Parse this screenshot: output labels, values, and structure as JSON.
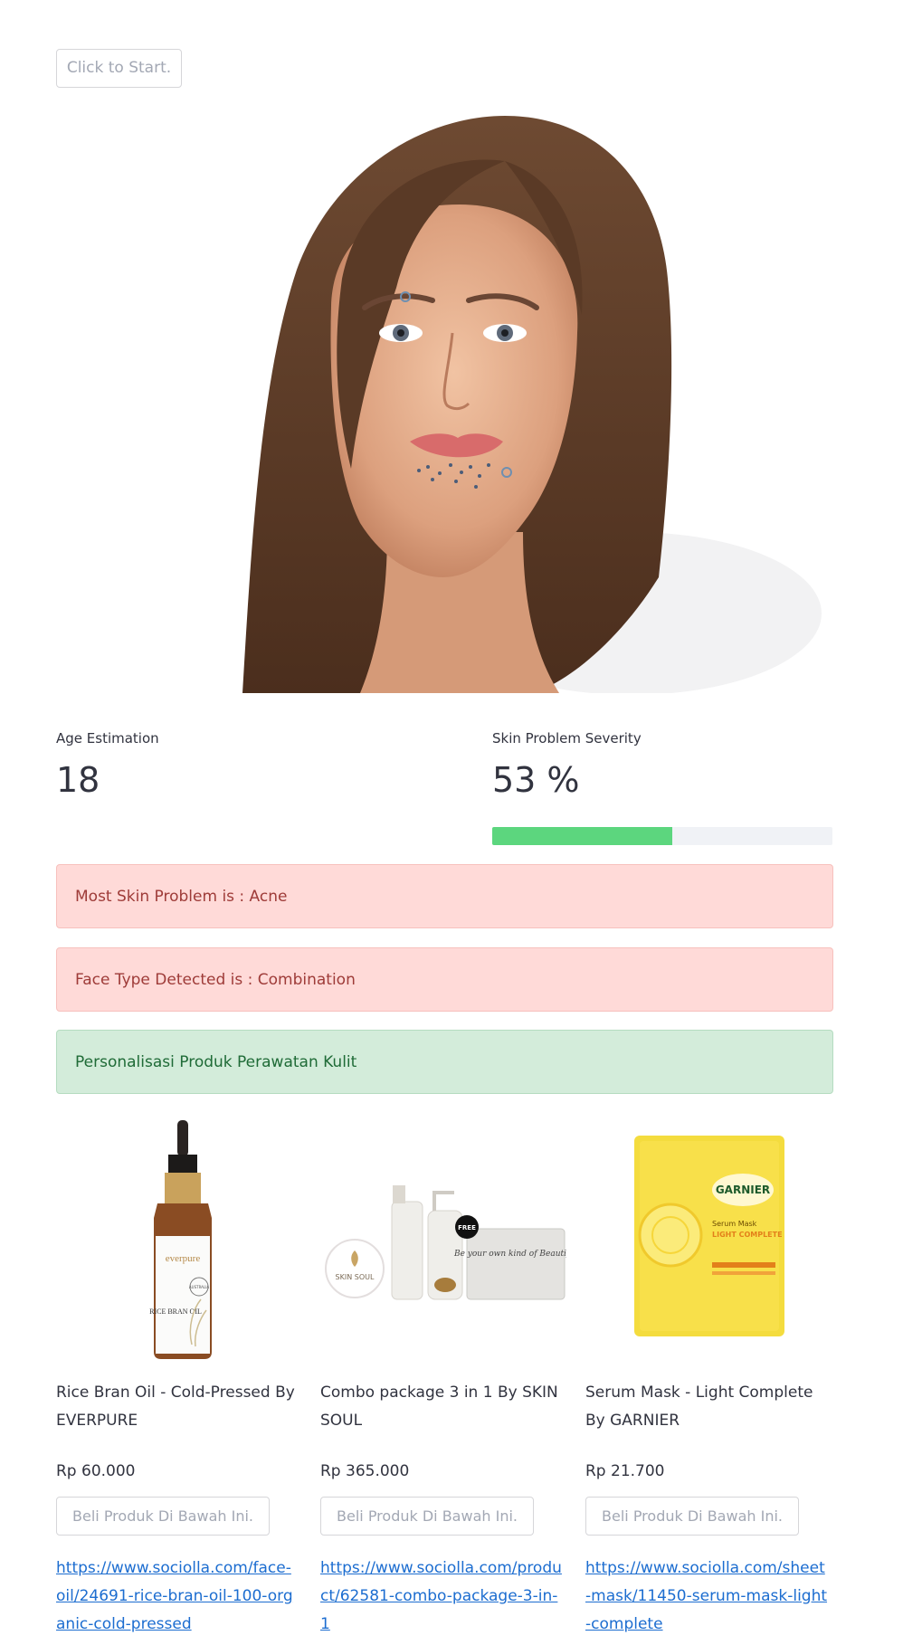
{
  "start_button": {
    "label": "Click to Start."
  },
  "metrics": {
    "age": {
      "label": "Age Estimation",
      "value": "18"
    },
    "severity": {
      "label": "Skin Problem Severity",
      "value": "53 %",
      "fraction": 0.53
    }
  },
  "alerts": {
    "problem": "Most Skin Problem is : Acne",
    "face_type": "Face Type Detected is : Combination",
    "personalization": "Personalisasi Produk Perawatan Kulit"
  },
  "products": [
    {
      "name": "Rice Bran Oil - Cold-Pressed By EVERPURE",
      "price": "Rp 60.000",
      "buy_label": "Beli Produk Di Bawah Ini.",
      "link": "https://www.sociolla.com/face-oil/24691-rice-bran-oil-100-organic-cold-pressed",
      "image_text": {
        "brand": "everpure",
        "name": "RICE BRAN OIL",
        "badge": "AUSTRALIA"
      }
    },
    {
      "name": "Combo package 3 in 1 By SKIN SOUL",
      "price": "Rp 365.000",
      "buy_label": "Beli Produk Di Bawah Ini.",
      "link": "https://www.sociolla.com/product/62581-combo-package-3-in-1",
      "image_text": {
        "brand": "SKIN SOUL",
        "free_badge": "FREE",
        "pouch_text": "Be your own kind of Beautiful"
      }
    },
    {
      "name": "Serum Mask - Light Complete By GARNIER",
      "price": "Rp 21.700",
      "buy_label": "Beli Produk Di Bawah Ini.",
      "link": "https://www.sociolla.com/sheet-mask/11450-serum-mask-light-complete",
      "image_text": {
        "brand": "GARNIER",
        "line1": "Serum Mask",
        "line2": "LIGHT COMPLETE"
      }
    }
  ],
  "colors": {
    "progress": "#5cd67e",
    "error_bg": "#ffdad8",
    "error_text": "#9e3b38",
    "success_bg": "#d3ecda",
    "success_text": "#1f6b37",
    "link": "#1c6dd0"
  }
}
